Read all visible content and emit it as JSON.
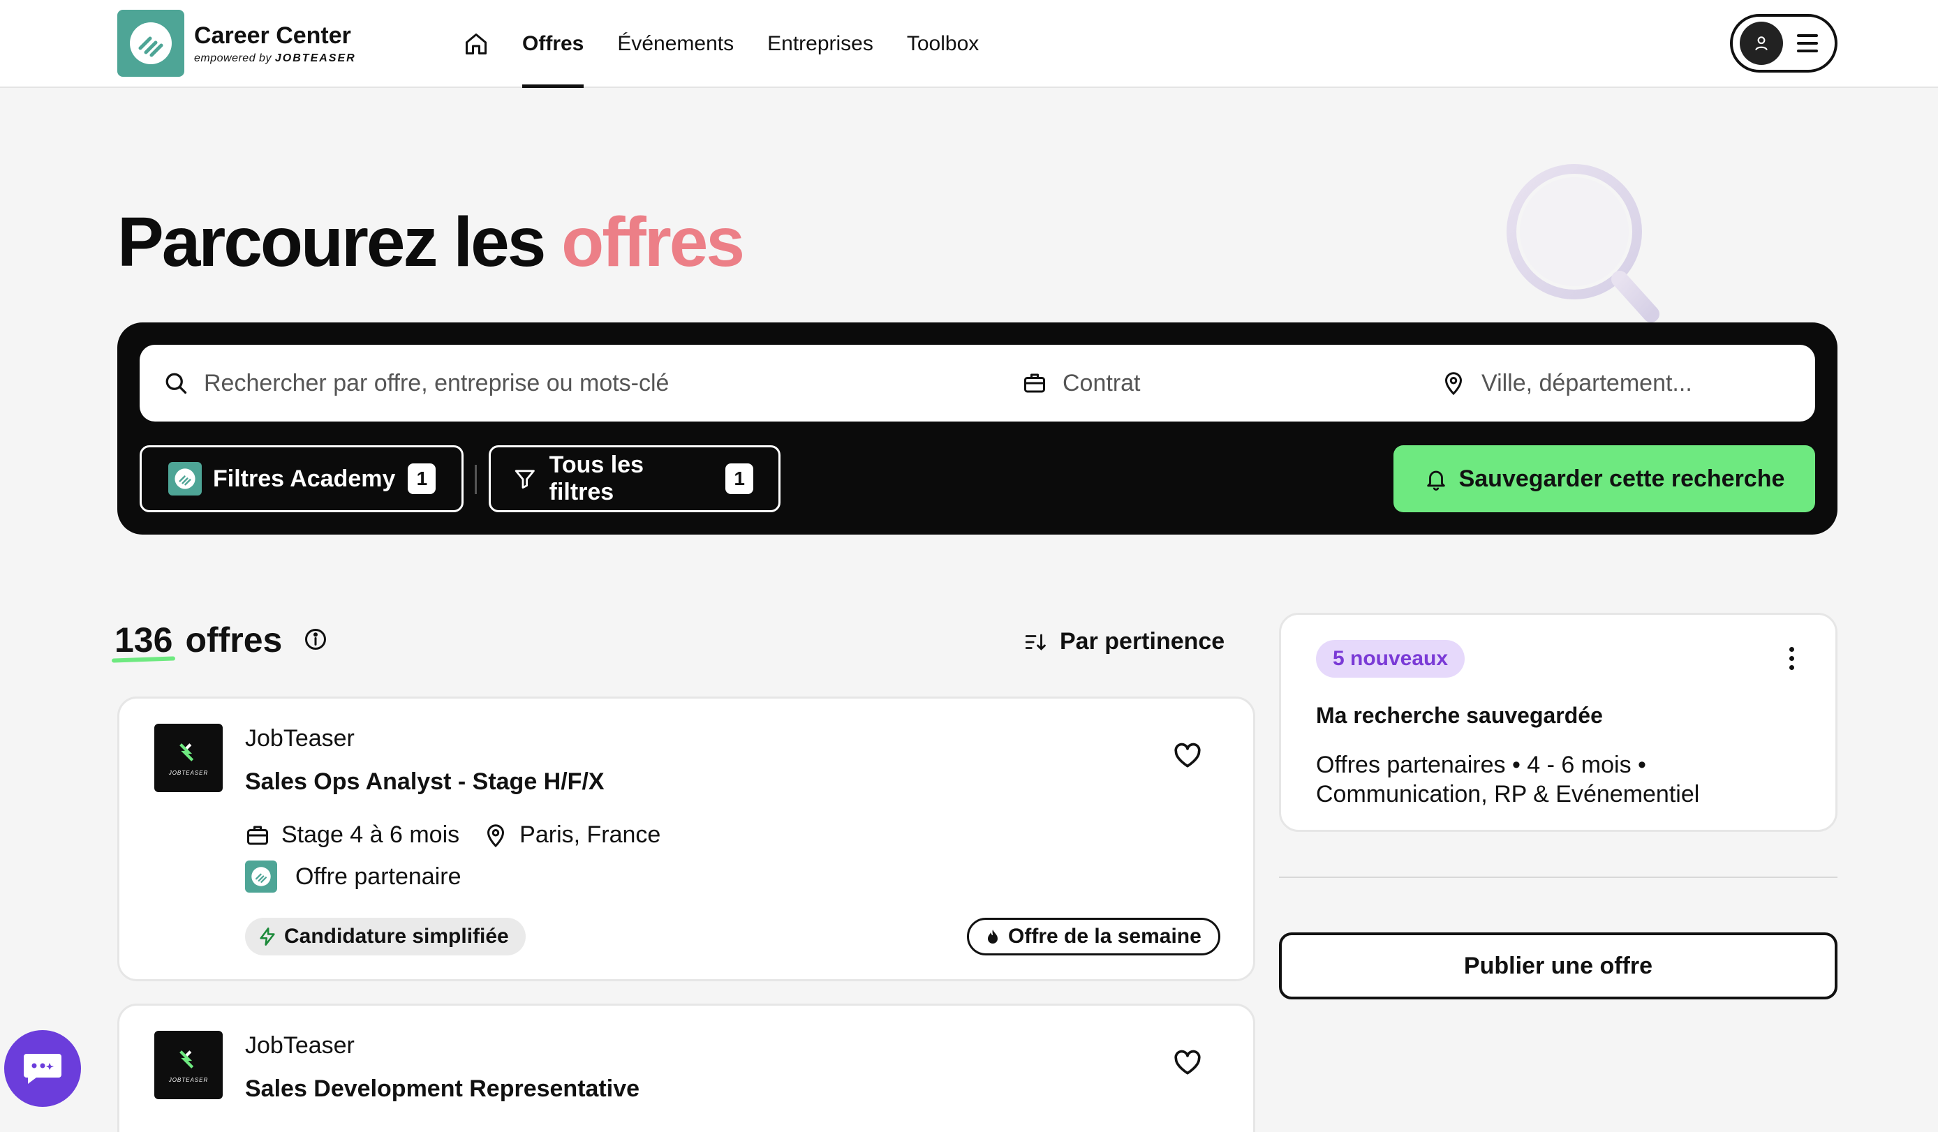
{
  "header": {
    "brand_title": "Career Center",
    "brand_sub_prefix": "empowered by",
    "brand_sub_name": "JOBTEASER",
    "nav": [
      "Offres",
      "Événements",
      "Entreprises",
      "Toolbox"
    ],
    "active_nav": "Offres"
  },
  "hero": {
    "title_main": "Parcourez les",
    "title_accent": "offres"
  },
  "search": {
    "keyword_placeholder": "Rechercher par offre, entreprise ou mots-clé",
    "contract_placeholder": "Contrat",
    "city_placeholder": "Ville, département...",
    "filters_academy_label": "Filtres Academy",
    "filters_academy_count": "1",
    "all_filters_label": "Tous les filtres",
    "all_filters_count": "1",
    "save_search_label": "Sauvegarder cette recherche"
  },
  "results": {
    "count_number": "136",
    "count_label": "offres",
    "sort_label": "Par pertinence"
  },
  "jobs": [
    {
      "company": "JobTeaser",
      "company_logo_tag": "JOBTEASER",
      "title": "Sales Ops Analyst - Stage H/F/X",
      "contract": "Stage 4 à 6 mois",
      "location": "Paris, France",
      "partner": "Offre partenaire",
      "badge_simple": "Candidature simplifiée",
      "badge_week": "Offre de la semaine"
    },
    {
      "company": "JobTeaser",
      "company_logo_tag": "JOBTEASER",
      "title": "Sales Development Representative"
    }
  ],
  "saved_search": {
    "new_badge": "5 nouveaux",
    "title": "Ma recherche sauvegardée",
    "description": "Offres partenaires • 4 - 6 mois • Communication, RP & Evénementiel"
  },
  "sidebar": {
    "publish_label": "Publier une offre"
  },
  "colors": {
    "accent_pink": "#ec7f87",
    "brand_teal": "#4ea596",
    "save_green": "#6ee980",
    "chat_purple": "#6b3ddb",
    "badge_purple_bg": "#e6d9fb"
  }
}
